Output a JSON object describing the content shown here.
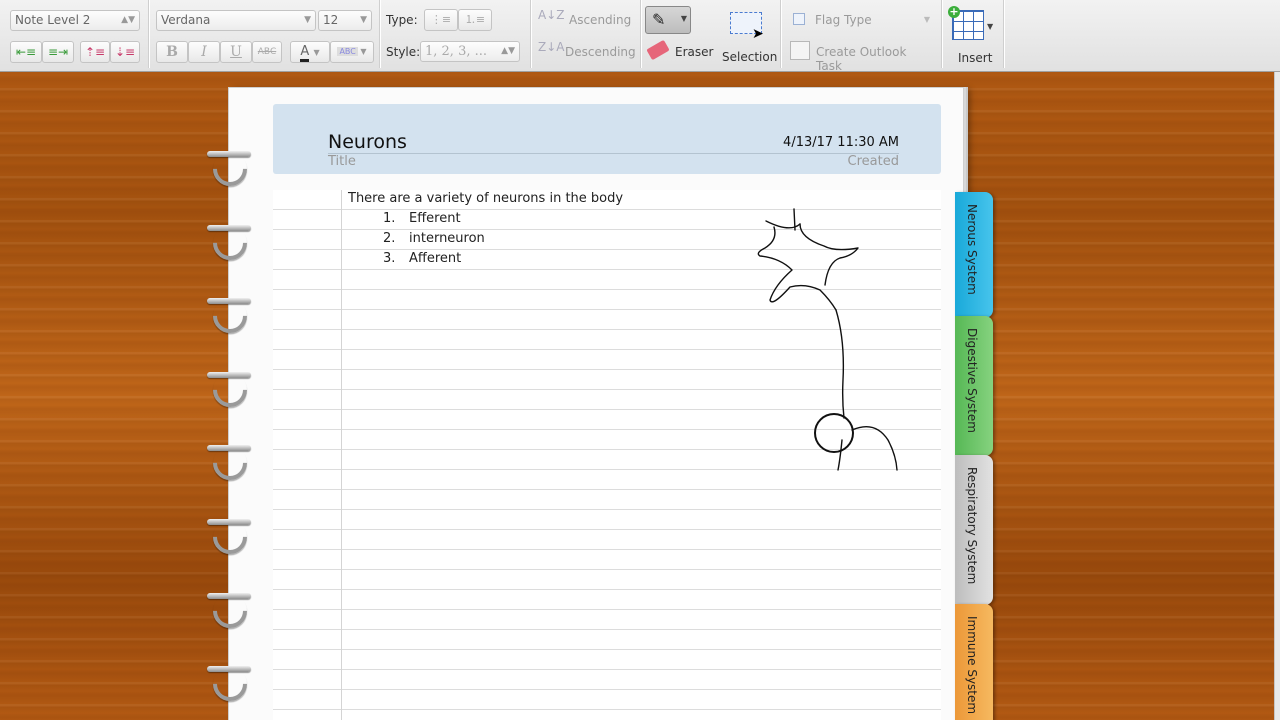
{
  "ribbon": {
    "note_levels": {
      "level_select": "Note Level 2"
    },
    "font": {
      "family": "Verdana",
      "size": "12",
      "bold": "B",
      "italic": "I",
      "underline": "U",
      "strike": "ABC",
      "font_color": "A",
      "highlight": "ABC"
    },
    "lists": {
      "type_label": "Type:",
      "style_label": "Style:",
      "style_value": "1, 2, 3, ..."
    },
    "sort": {
      "ascending": "Ascending",
      "descending": "Descending"
    },
    "scribble": {
      "eraser": "Eraser",
      "selection": "Selection"
    },
    "note_flags": {
      "flag_type": "Flag Type",
      "outlook_task": "Create Outlook Task"
    },
    "tables": {
      "insert": "Insert"
    }
  },
  "note": {
    "title": "Neurons",
    "title_label": "Title",
    "created": "4/13/17 11:30 AM",
    "created_label": "Created",
    "intro": "There are a variety of neurons in the body",
    "items": [
      {
        "num": "1.",
        "text": "Efferent"
      },
      {
        "num": "2.",
        "text": "interneuron"
      },
      {
        "num": "3.",
        "text": "Afferent"
      }
    ]
  },
  "tabs": [
    {
      "label": "Nerous System",
      "color": "#2fb7e3"
    },
    {
      "label": "Digestive System",
      "color": "#6cc56a"
    },
    {
      "label": "Respiratory System",
      "color": "#cfcfcf"
    },
    {
      "label": "Immune System",
      "color": "#f1a64a"
    }
  ]
}
